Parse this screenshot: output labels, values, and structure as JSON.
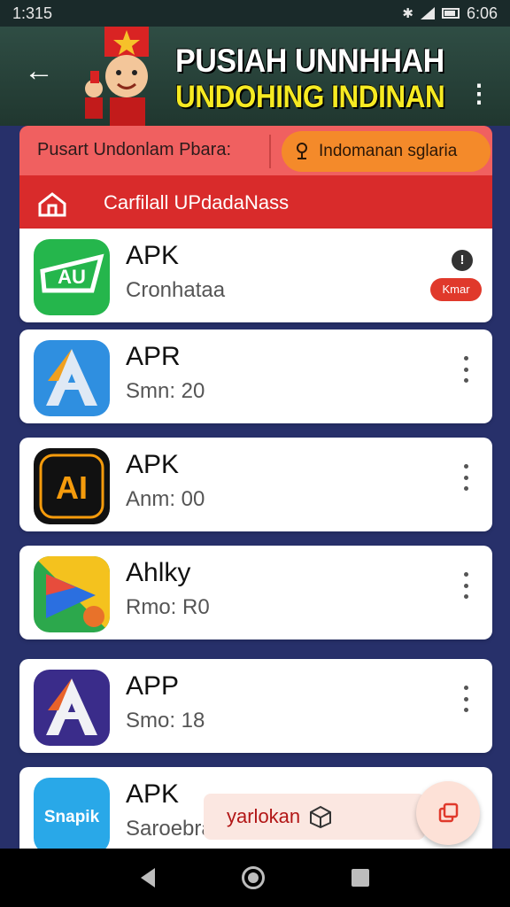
{
  "status_bar": {
    "time": "1:315",
    "clock_right": "6:06",
    "icons": [
      "bluetooth-icon",
      "signal-icon",
      "battery-icon"
    ]
  },
  "app_bar": {
    "title": "PUSIAH UNNHHAH",
    "subtitle": "UNDOHING INDINAN",
    "back_icon": "back-arrow-icon",
    "more_icon": "more-vert-icon"
  },
  "panel": {
    "title": "Pusart Undonlam Pbara:",
    "button_label": "Indomanan sglaria",
    "subtitle": "Carfilall UPdadaNass",
    "colors": {
      "accent": "#d92b2b",
      "tab": "#f06060",
      "pill": "#f48a2a"
    }
  },
  "apps": [
    {
      "name": "APK",
      "meta": "Cronhataa",
      "icon": "au-app-icon",
      "badge": "Kmar",
      "action": "info-icon"
    },
    {
      "name": "APR",
      "meta": "Smn: 20",
      "icon": "a-app-icon"
    },
    {
      "name": "APK",
      "meta": "Anm: 00",
      "icon": "ai-app-icon"
    },
    {
      "name": "Ahlky",
      "meta": "Rmo: R0",
      "icon": "play-app-icon"
    },
    {
      "name": "APP",
      "meta": "Smo: 18",
      "icon": "a-purple-app-icon"
    },
    {
      "name": "APK",
      "meta": "Saroebra",
      "icon": "snapik-app-icon",
      "icon_text": "Snapik"
    }
  ],
  "promo": {
    "label": "yarlokan",
    "icon": "box-icon"
  },
  "fab": {
    "icon": "copy-icon"
  },
  "nav": {
    "icons": [
      "nav-back-icon",
      "nav-home-icon",
      "nav-recent-icon"
    ]
  }
}
